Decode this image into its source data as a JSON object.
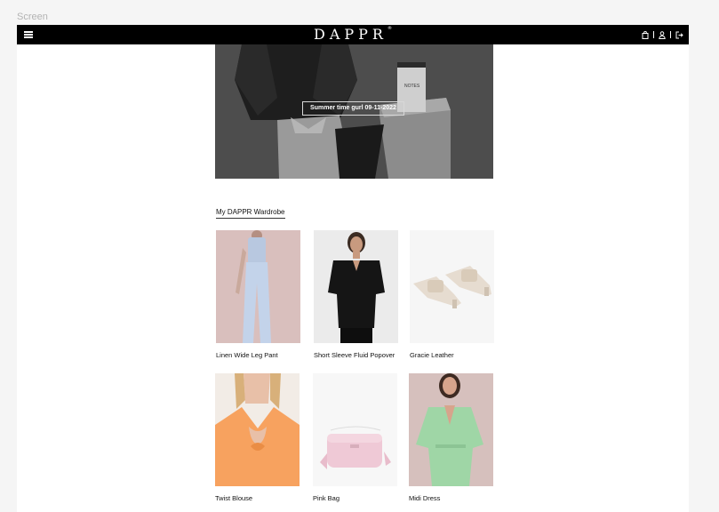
{
  "frame": {
    "label": "Screen"
  },
  "header": {
    "logo": "DAPPR",
    "logo_mark": "®",
    "icons": [
      "menu-icon",
      "bag-icon",
      "user-icon",
      "logout-icon"
    ]
  },
  "hero": {
    "caption": "Summer time gurl 09-11-2022",
    "box_text": "NOTES"
  },
  "wardrobe": {
    "title": "My DAPPR Wardrobe",
    "items": [
      {
        "name": "Linen Wide Leg Pant"
      },
      {
        "name": "Short Sleeve Fluid Popover"
      },
      {
        "name": "Gracie Leather"
      },
      {
        "name": "Twist Blouse"
      },
      {
        "name": "Pink Bag"
      },
      {
        "name": "Midi Dress"
      }
    ]
  },
  "colors": {
    "navbar": "#000000",
    "hero_overlay": "#4b4b4b",
    "page_bg": "#f5f5f5"
  }
}
